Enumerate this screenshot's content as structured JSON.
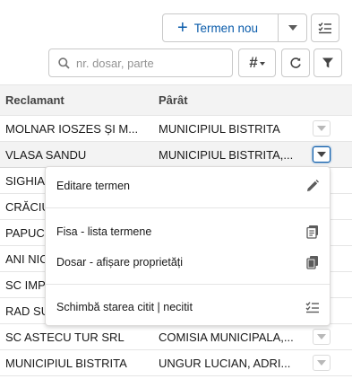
{
  "toolbar": {
    "new_term_label": "Termen nou",
    "search_placeholder": "nr. dosar, parte",
    "hash_label": "#"
  },
  "table": {
    "columns": [
      "Reclamant",
      "Pârât"
    ],
    "rows": [
      [
        "MOLNAR IOSZES ȘI M...",
        "MUNICIPIUL BISTRITA"
      ],
      [
        "VLASA SANDU",
        "MUNICIPIUL BISTRITA,..."
      ],
      [
        "SIGHIA",
        ""
      ],
      [
        "CRĂCIU",
        ""
      ],
      [
        "PAPUC",
        ""
      ],
      [
        "ANI NIC",
        ""
      ],
      [
        "SC IMP",
        ""
      ],
      [
        "RAD SU",
        ""
      ],
      [
        "SC ASTECU TUR SRL",
        "COMISIA MUNICIPALA,..."
      ],
      [
        "MUNICIPIUL BISTRITA",
        "UNGUR LUCIAN, ADRI..."
      ]
    ]
  },
  "context_menu": {
    "items": [
      {
        "label": "Editare termen",
        "icon": "pencil-icon"
      },
      {
        "label": "Fisa - lista termene",
        "icon": "document-list-icon"
      },
      {
        "label": "Dosar - afișare proprietăți",
        "icon": "copy-icon"
      },
      {
        "label": "Schimbă starea citit | necitit",
        "icon": "checklist-icon"
      }
    ]
  },
  "colors": {
    "brand_blue": "#0b5cab",
    "header_bg": "#f3f3f3",
    "border": "#c9c9c9"
  }
}
